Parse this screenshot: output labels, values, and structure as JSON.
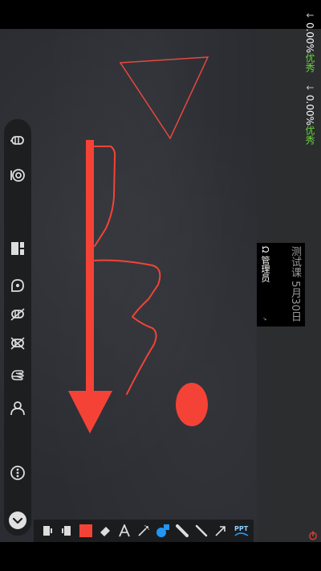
{
  "status": {
    "stat1": {
      "arrow": "↓",
      "value": "0.00%",
      "label": "优秀"
    },
    "stat2": {
      "arrow": "↓",
      "value": "0.00%",
      "label": "优秀"
    }
  },
  "session": {
    "title": "测试课 5月30日",
    "user": "Ω 管理员",
    "signal": "↗"
  },
  "sidebar": {
    "items": [
      {
        "icon": "mic-icon"
      },
      {
        "icon": "camera-icon"
      },
      {
        "icon": "layout-icon"
      },
      {
        "icon": "chat-icon"
      },
      {
        "icon": "mute-all-icon"
      },
      {
        "icon": "unmute-all-icon"
      },
      {
        "icon": "raise-hand-icon"
      },
      {
        "icon": "users-icon"
      },
      {
        "icon": "more-icon"
      },
      {
        "icon": "collapse-icon"
      }
    ]
  },
  "toolbar": {
    "items": [
      {
        "icon": "prev-page-icon"
      },
      {
        "icon": "next-page-icon"
      },
      {
        "icon": "color-swatch-icon",
        "color": "#f44336"
      },
      {
        "icon": "eraser-icon"
      },
      {
        "icon": "text-icon"
      },
      {
        "icon": "laser-icon"
      },
      {
        "icon": "shape-icon"
      },
      {
        "icon": "marker-icon"
      },
      {
        "icon": "pen-icon"
      },
      {
        "icon": "pointer-icon"
      },
      {
        "icon": "ppt-icon",
        "label": "PPT"
      }
    ]
  },
  "colors": {
    "ink": "#f44336",
    "board": "#2a2c32",
    "good": "#6ad43f"
  }
}
